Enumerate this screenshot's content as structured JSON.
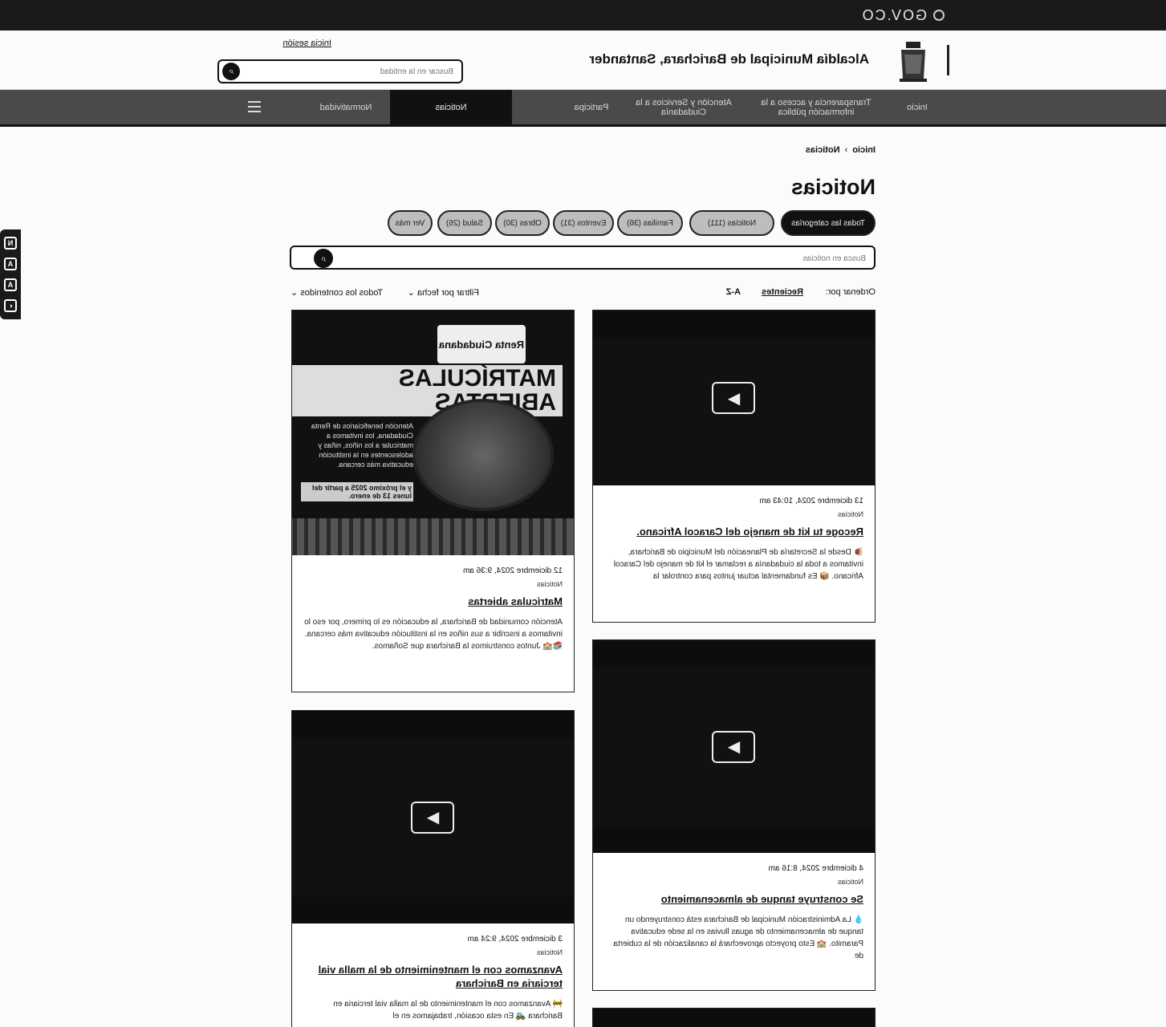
{
  "gov_bar": {
    "label": "GOV.CO"
  },
  "header": {
    "org_name": "Alcaldía Municipal de Barichara, Santander",
    "login_label": "Inicia sesión",
    "search_placeholder": "Buscar en la entidad"
  },
  "nav": {
    "items": [
      {
        "label": "Inicio"
      },
      {
        "label": "Transparencia y acceso a la información pública"
      },
      {
        "label": "Atención y Servicios a la Ciudadanía"
      },
      {
        "label": "Participa"
      },
      {
        "label": "Noticias"
      },
      {
        "label": "Normatividad"
      }
    ],
    "active": "Noticias"
  },
  "accessibility": {
    "buttons": [
      "N",
      "A",
      "A",
      "◐"
    ]
  },
  "breadcrumb": {
    "home": "Inicio",
    "separator": "›",
    "current": "Noticias"
  },
  "page_title": "Noticias",
  "categories": [
    "Todas las categorías",
    "Noticias (111)",
    "Familias (36)",
    "Eventos (31)",
    "Obras (30)",
    "Salud (26)",
    "Ver más"
  ],
  "news_search": {
    "placeholder": "Busca en noticias"
  },
  "sort": {
    "label": "Ordenar por:",
    "options": [
      "Recientes",
      "A-Z"
    ],
    "active": "Recientes",
    "date_filter": "Filtrar por fecha",
    "content_filter": "Todos los contenidos"
  },
  "cards": [
    {
      "date": "13 diciembre 2024, 10:43 am",
      "category": "Noticias",
      "title": "Recoge tu kit de manejo del Caracol Africano.",
      "excerpt": "🐌 Desde la Secretaría de Planeación del Municipio de Barichara, invitamos a toda la ciudadanía a reclamar el kit de manejo del Caracol Africano. 📦 Es fundamental actuar juntos para controlar la"
    },
    {
      "date": "12 diciembre 2024, 9:36 am",
      "category": "Noticias",
      "title": "Matrículas abiertas",
      "excerpt": "Atención comunidad de Barichara, la educación es lo primero, por eso lo invitamos a inscribir a sus niños en la institución educativa más cercana. 📚🏫 Juntos construimos la Barichara que Soñamos.",
      "poster": {
        "headline": "MATRÍCULAS ABIERTAS",
        "brand": "Renta Ciudadana",
        "text": "Atención beneficiarios de Renta Ciudadana, los invitamos a matricular a los niños, niñas y adolescentes en la institución educativa más cercana.",
        "date_text": "y el próximo 2025 a partir del lunes 13 de enero."
      }
    },
    {
      "date": "4 diciembre 2024, 8:16 am",
      "category": "Noticias",
      "title": "Se construye tanque de almacenamiento",
      "excerpt": "💧 La Administración Municipal de Barichara está construyendo un tanque de almacenamiento de aguas lluvias en la sede educativa Paramito. 🏫 Esto proyecto aprovechará la canalización de la cubierta de"
    },
    {
      "date": "3 diciembre 2024, 9:24 am",
      "category": "Noticias",
      "title": "Avanzamos con el mantenimiento de la malla vial terciaria en Barichara",
      "excerpt": "🚧 Avanzamos con el mantenimiento de la malla vial terciaria en Barichara 🚜 En esta ocasión, trabajamos en el"
    }
  ],
  "colors": {
    "nav_bg": "#4a4a4a",
    "active_bg": "#111111",
    "gov_bar": "#1a1a1a"
  },
  "icons": [
    "search-icon",
    "menu-icon",
    "play-icon",
    "chevron-down-icon",
    "contrast-icon",
    "text-size-icon"
  ]
}
